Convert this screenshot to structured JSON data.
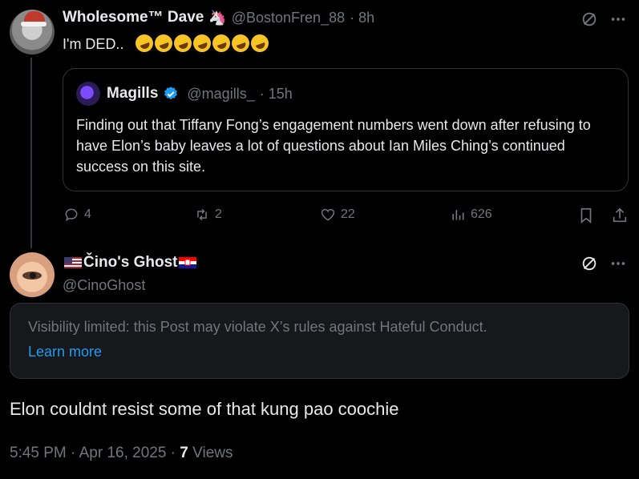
{
  "tweet1": {
    "author_name": "Wholesome™ Dave",
    "author_emoji": "🦄",
    "handle": "@BostonFren_88",
    "time": "· 8h",
    "text": "I'm DED..",
    "emoji_count": 7,
    "quote": {
      "author_name": "Magills",
      "handle": "@magills_",
      "time": "· 15h",
      "text": "Finding out that Tiffany Fong’s engagement numbers went down after refusing to have Elon’s baby leaves a lot of questions about Ian Miles Ching’s continued success on this site."
    },
    "actions": {
      "replies": "4",
      "reposts": "2",
      "likes": "22",
      "views": "626"
    }
  },
  "tweet2": {
    "author_name": "Čino's Ghost",
    "handle": "@CinoGhost",
    "notice_text": "Visibility limited: this Post may violate X’s rules against Hateful Conduct.",
    "learn_more": "Learn more",
    "text": "Elon couldnt resist some of that kung pao coochie",
    "timestamp": "5:45 PM · Apr 16, 2025 ·",
    "views_count": "7",
    "views_label": "Views"
  },
  "colors": {
    "background": "#000000",
    "text": "#e7e9ea",
    "muted": "#71767b",
    "accent": "#1d9bf0",
    "border": "#2f3336"
  }
}
